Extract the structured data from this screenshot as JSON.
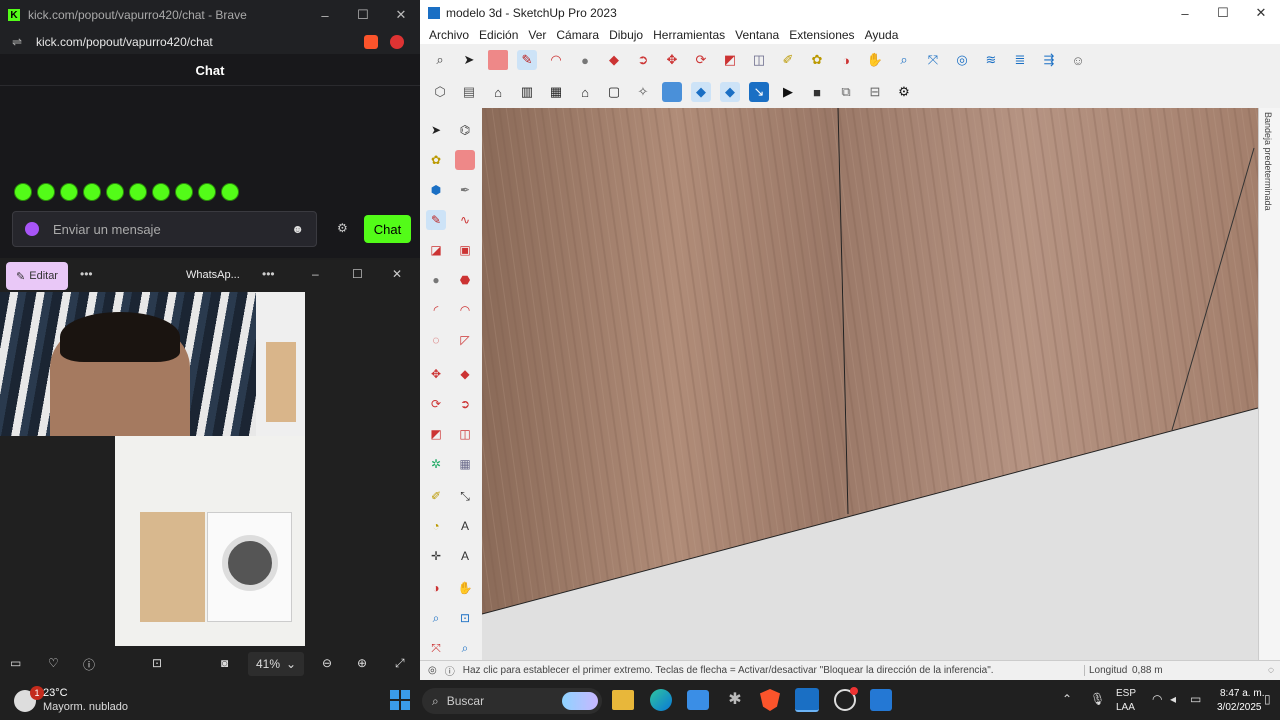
{
  "brave": {
    "title": "kick.com/popout/vapurro420/chat - Brave",
    "url": "kick.com/popout/vapurro420/chat",
    "chat_header": "Chat",
    "message_placeholder": "Enviar un mensaje",
    "send_label": "Chat"
  },
  "whatsapp": {
    "edit_label": "Editar",
    "title": "WhatsAp...",
    "zoom": "41%"
  },
  "sketchup": {
    "title": "modelo 3d - SketchUp Pro 2023",
    "menu": [
      "Archivo",
      "Edición",
      "Ver",
      "Cámara",
      "Dibujo",
      "Herramientas",
      "Ventana",
      "Extensiones",
      "Ayuda"
    ],
    "tray_label": "Bandeja predeterminada",
    "status": "Haz clic para establecer el primer extremo. Teclas de flecha = Activar/desactivar \"Bloquear la dirección de la inferencia\".",
    "measure_label": "Longitud",
    "measure_value": "0,88 m"
  },
  "taskbar": {
    "weather_temp": "23°C",
    "weather_desc": "Mayorm. nublado",
    "search": "Buscar",
    "lang_top": "ESP",
    "lang_bottom": "LAA",
    "time": "8:47 a. m.",
    "date": "3/02/2025",
    "notif_badge": "1"
  },
  "colors": {
    "kick_green": "#53fc18",
    "su_accent": "#1a6fc4",
    "taskbar": "#202020"
  }
}
